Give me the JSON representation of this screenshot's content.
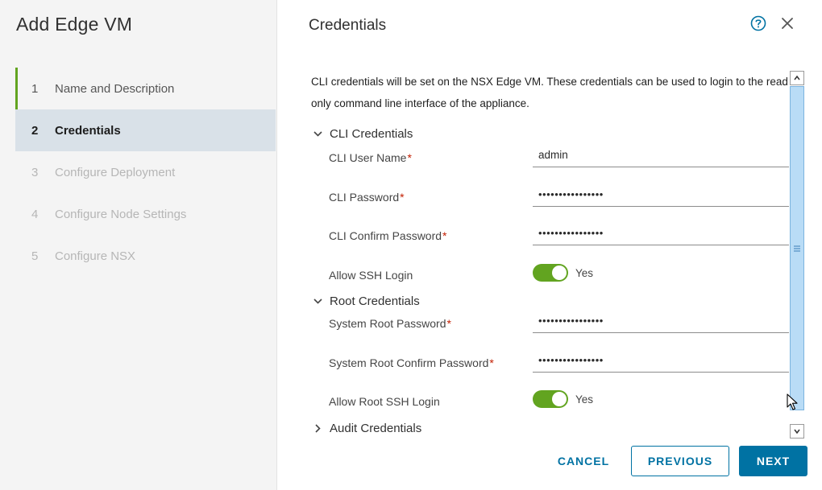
{
  "wizard": {
    "title": "Add Edge VM",
    "steps": [
      {
        "num": "1",
        "label": "Name and Description",
        "state": "done"
      },
      {
        "num": "2",
        "label": "Credentials",
        "state": "current"
      },
      {
        "num": "3",
        "label": "Configure Deployment",
        "state": "disabled"
      },
      {
        "num": "4",
        "label": "Configure Node Settings",
        "state": "disabled"
      },
      {
        "num": "5",
        "label": "Configure NSX",
        "state": "disabled"
      }
    ]
  },
  "header": {
    "title": "Credentials",
    "help_icon": "help-circle-icon",
    "close_icon": "close-icon"
  },
  "description": "CLI credentials will be set on the NSX Edge VM. These credentials can be used to login to the read only command line interface of the appliance.",
  "cli": {
    "section_title": "CLI Credentials",
    "user_name_label": "CLI User Name",
    "user_name_value": "admin",
    "password_label": "CLI Password",
    "password_value": "••••••••••••••••",
    "confirm_label": "CLI Confirm Password",
    "confirm_value": "••••••••••••••••",
    "ssh_label": "Allow SSH Login",
    "ssh_value": "Yes",
    "ssh_enabled": true
  },
  "root": {
    "section_title": "Root Credentials",
    "password_label": "System Root Password",
    "password_value": "••••••••••••••••",
    "confirm_label": "System Root Confirm Password",
    "confirm_value": "••••••••••••••••",
    "ssh_label": "Allow Root SSH Login",
    "ssh_value": "Yes",
    "ssh_enabled": true
  },
  "audit": {
    "section_title": "Audit Credentials",
    "expanded": false
  },
  "required_marker": "*",
  "footer": {
    "cancel": "CANCEL",
    "previous": "PREVIOUS",
    "next": "NEXT"
  },
  "colors": {
    "accent": "#0072a3",
    "toggle_on": "#62a420",
    "step_done_bar": "#62a420",
    "current_step_bg": "#d9e1e8",
    "required": "#c21d00",
    "scroll_thumb": "#b9dcf6"
  }
}
